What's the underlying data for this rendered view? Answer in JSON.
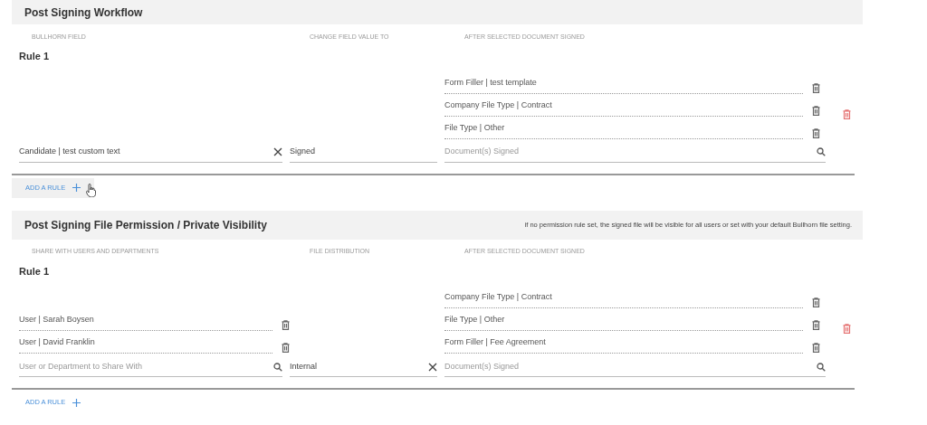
{
  "sections": [
    {
      "title": "Post Signing Workflow",
      "column_headings": [
        "BULLHORN FIELD",
        "CHANGE FIELD VALUE TO",
        "AFTER SELECTED DOCUMENT SIGNED"
      ],
      "rules": [
        {
          "title": "Rule 1",
          "left": {
            "field": {
              "value": "Candidate | test custom text",
              "kind": "clear"
            }
          },
          "middle": {
            "field": {
              "value": "Signed",
              "kind": "none"
            }
          },
          "right": {
            "items": [
              "Form Filler | test template",
              "Company File Type | Contract",
              "File Type | Other"
            ],
            "field": {
              "placeholder": "Document(s) Signed",
              "kind": "search"
            }
          }
        }
      ],
      "add_button": {
        "label": "ADD A RULE",
        "hovered": true
      }
    },
    {
      "title": "Post Signing File Permission / Private Visibility",
      "note": "if no permission rule set, the signed file will be visible for all users or set with your default Bullhorn file setting.",
      "column_headings": [
        "SHARE WITH USERS AND DEPARTMENTS",
        "FILE DISTRIBUTION",
        "AFTER SELECTED DOCUMENT SIGNED"
      ],
      "rules": [
        {
          "title": "Rule 1",
          "left": {
            "items": [
              "User | Sarah Boysen",
              "User | David Franklin"
            ],
            "field": {
              "placeholder": "User or Department to Share With",
              "kind": "search"
            }
          },
          "middle": {
            "field": {
              "value": "Internal",
              "kind": "clear"
            }
          },
          "right": {
            "items": [
              "Company File Type | Contract",
              "File Type | Other",
              "Form Filler | Fee Agreement"
            ],
            "field": {
              "placeholder": "Document(s) Signed",
              "kind": "search"
            }
          }
        }
      ],
      "add_button": {
        "label": "ADD A RULE",
        "hovered": false
      }
    }
  ]
}
